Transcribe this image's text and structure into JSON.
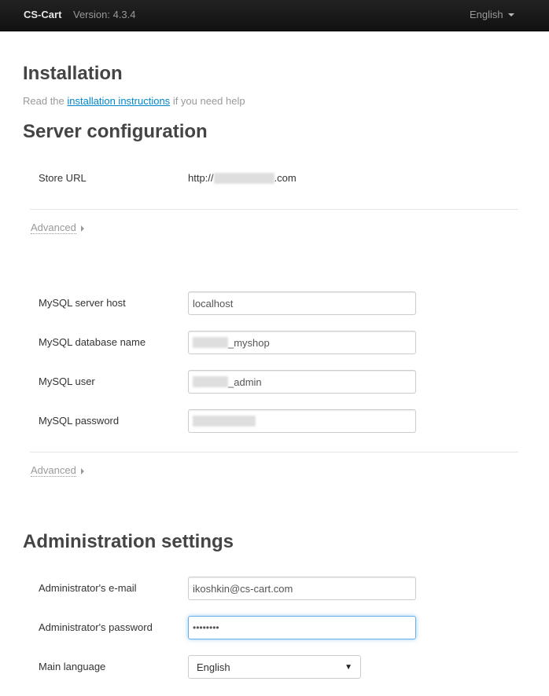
{
  "navbar": {
    "brand": "CS-Cart",
    "version": "Version: 4.3.4",
    "language": "English",
    "language_icon": "caret-down"
  },
  "installation": {
    "title": "Installation",
    "help_prefix": "Read the",
    "help_link": "installation instructions",
    "help_suffix": "if you need help"
  },
  "server": {
    "title": "Server configuration",
    "store_url": {
      "label": "Store URL",
      "prefix": "http://",
      "suffix": ".com"
    },
    "advanced_label": "Advanced",
    "mysql": {
      "host": {
        "label": "MySQL server host",
        "value": "localhost"
      },
      "database": {
        "label": "MySQL database name",
        "value_suffix": "_myshop"
      },
      "user": {
        "label": "MySQL user",
        "value_suffix": "_admin"
      },
      "password": {
        "label": "MySQL password"
      }
    },
    "advanced_label_2": "Advanced"
  },
  "admin": {
    "title": "Administration settings",
    "email": {
      "label": "Administrator's e-mail",
      "value": "ikoshkin@cs-cart.com"
    },
    "password": {
      "label": "Administrator's password",
      "value": "••••••••"
    },
    "language": {
      "label": "Main language",
      "selected": "English"
    }
  }
}
